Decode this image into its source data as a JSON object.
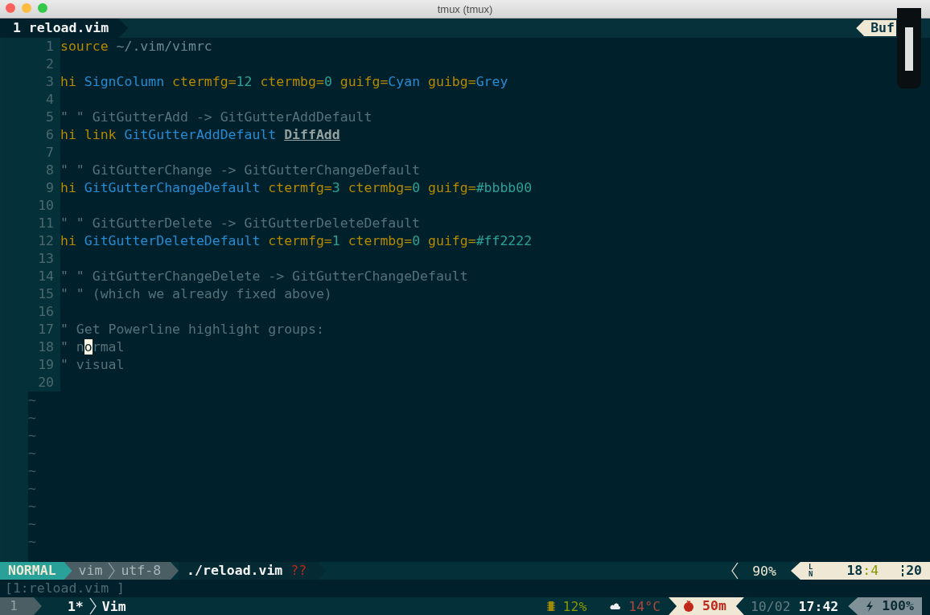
{
  "window": {
    "title": "tmux (tmux)"
  },
  "tmux_tab": {
    "label": "1 reload.vim"
  },
  "buffer_tag": {
    "label": "Buf"
  },
  "lines": [
    {
      "number": "1",
      "tokens": [
        {
          "text": "source",
          "kind": "keyword"
        },
        {
          "text": " ~/.vim/vimrc",
          "kind": "path"
        }
      ]
    },
    {
      "number": "2"
    },
    {
      "number": "3",
      "tokens": [
        {
          "text": "hi ",
          "kind": "keyword"
        },
        {
          "text": "SignColumn ",
          "kind": "ident"
        },
        {
          "text": "ctermfg=",
          "kind": "option"
        },
        {
          "text": "12 ",
          "kind": "value"
        },
        {
          "text": "ctermbg=",
          "kind": "option"
        },
        {
          "text": "0 ",
          "kind": "value"
        },
        {
          "text": "guifg=",
          "kind": "option"
        },
        {
          "text": "Cyan ",
          "kind": "ident"
        },
        {
          "text": "guibg=",
          "kind": "option"
        },
        {
          "text": "Grey",
          "kind": "ident"
        }
      ]
    },
    {
      "number": "4"
    },
    {
      "number": "5",
      "tokens": [
        {
          "text": "\" \" GitGutterAdd -> GitGutterAddDefault",
          "kind": "comment"
        }
      ]
    },
    {
      "number": "6",
      "tokens": [
        {
          "text": "hi link ",
          "kind": "keyword"
        },
        {
          "text": "GitGutterAddDefault ",
          "kind": "ident"
        },
        {
          "text": "DiffAdd",
          "kind": "link"
        }
      ]
    },
    {
      "number": "7"
    },
    {
      "number": "8",
      "tokens": [
        {
          "text": "\" \" GitGutterChange -> GitGutterChangeDefault",
          "kind": "comment"
        }
      ]
    },
    {
      "number": "9",
      "tokens": [
        {
          "text": "hi ",
          "kind": "keyword"
        },
        {
          "text": "GitGutterChangeDefault ",
          "kind": "ident"
        },
        {
          "text": "ctermfg=",
          "kind": "option"
        },
        {
          "text": "3 ",
          "kind": "value"
        },
        {
          "text": "ctermbg=",
          "kind": "option"
        },
        {
          "text": "0 ",
          "kind": "value"
        },
        {
          "text": "guifg=",
          "kind": "option"
        },
        {
          "text": "#bbbb00",
          "kind": "value"
        }
      ]
    },
    {
      "number": "10"
    },
    {
      "number": "11",
      "tokens": [
        {
          "text": "\" \" GitGutterDelete -> GitGutterDeleteDefault",
          "kind": "comment"
        }
      ]
    },
    {
      "number": "12",
      "tokens": [
        {
          "text": "hi ",
          "kind": "keyword"
        },
        {
          "text": "GitGutterDeleteDefault ",
          "kind": "ident"
        },
        {
          "text": "ctermfg=",
          "kind": "option"
        },
        {
          "text": "1 ",
          "kind": "value"
        },
        {
          "text": "ctermbg=",
          "kind": "option"
        },
        {
          "text": "0 ",
          "kind": "value"
        },
        {
          "text": "guifg=",
          "kind": "option"
        },
        {
          "text": "#ff2222",
          "kind": "value"
        }
      ]
    },
    {
      "number": "13"
    },
    {
      "number": "14",
      "tokens": [
        {
          "text": "\" \" GitGutterChangeDelete -> GitGutterChangeDefault",
          "kind": "comment"
        }
      ]
    },
    {
      "number": "15",
      "tokens": [
        {
          "text": "\" \" (which we already fixed above)",
          "kind": "comment"
        }
      ]
    },
    {
      "number": "16"
    },
    {
      "number": "17",
      "tokens": [
        {
          "text": "\" Get Powerline highlight groups:",
          "kind": "comment"
        }
      ]
    },
    {
      "number": "18",
      "tokens": [
        {
          "text": "\" n",
          "kind": "comment"
        },
        {
          "text": "o",
          "kind": "cursor"
        },
        {
          "text": "rmal",
          "kind": "comment"
        }
      ]
    },
    {
      "number": "19",
      "tokens": [
        {
          "text": "\" visual",
          "kind": "comment"
        }
      ]
    },
    {
      "number": "20"
    }
  ],
  "tildes": [
    "~",
    "~",
    "~",
    "~",
    "~",
    "~",
    "~",
    "~",
    "~"
  ],
  "vim_status": {
    "mode": "NORMAL",
    "filetype": "vim",
    "encoding": "utf-8",
    "file": "./reload.vim",
    "flags": "??",
    "percent": "90%",
    "line_glyph": "LN",
    "line": "18",
    "column": ":4",
    "total": "20"
  },
  "command_line": "[1:reload.vim ]",
  "tmux_status": {
    "session": "1",
    "window_index": "1*",
    "window_name": "Vim",
    "cpu": "12%",
    "weather": "14°C",
    "pomodoro": "50m",
    "date": "10/02",
    "time": "17:42",
    "battery": "100%"
  }
}
